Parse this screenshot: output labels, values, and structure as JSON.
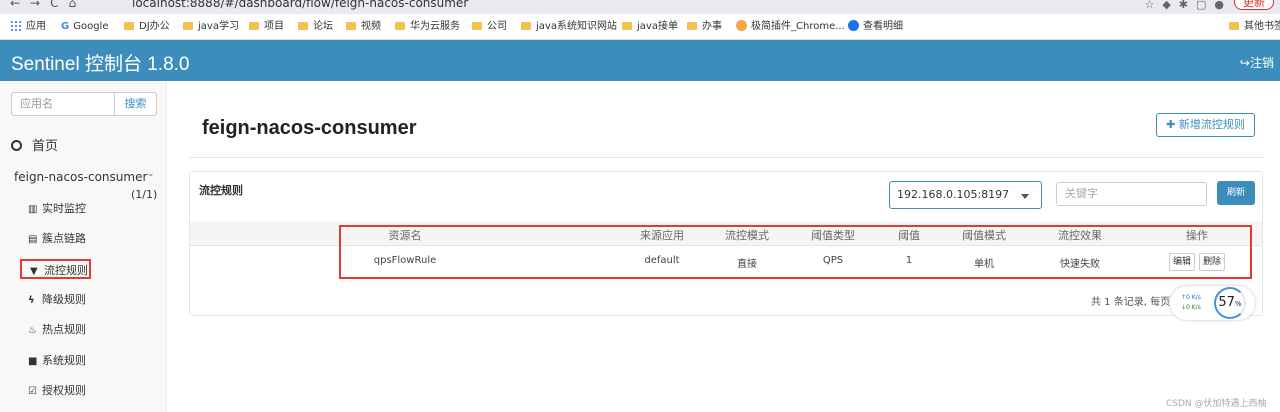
{
  "browser": {
    "url": "localhost:8888/#/dashboard/flow/feign-nacos-consumer",
    "update_label": "更新",
    "bookmarks": [
      "应用",
      "Google",
      "DJ办公",
      "java学习",
      "项目",
      "论坛",
      "视频",
      "华为云服务",
      "公司",
      "java系统知识网站",
      "java接单",
      "办事",
      "极简插件_Chrome...",
      "查看明细"
    ],
    "other_bookmarks": "其他书签"
  },
  "header": {
    "title": "Sentinel 控制台 1.8.0",
    "logout_label": "注销"
  },
  "sidebar": {
    "search_placeholder": "应用名",
    "search_button": "搜索",
    "home_label": "首页",
    "app_name": "feign-nacos-consumer",
    "app_count": "(1/1)",
    "items": [
      {
        "label": "实时监控",
        "icon": "bar-chart-icon"
      },
      {
        "label": "簇点链路",
        "icon": "list-icon"
      },
      {
        "label": "流控规则",
        "icon": "filter-icon"
      },
      {
        "label": "降级规则",
        "icon": "flash-icon"
      },
      {
        "label": "热点规则",
        "icon": "fire-icon"
      },
      {
        "label": "系统规则",
        "icon": "lock-icon"
      },
      {
        "label": "授权规则",
        "icon": "check-icon"
      }
    ]
  },
  "main": {
    "page_title": "feign-nacos-consumer",
    "add_button": "新增流控规则",
    "panel_title": "流控规则",
    "machine_select": "192.168.0.105:8197",
    "keyword_placeholder": "关键字",
    "refresh_button": "刷新",
    "columns": [
      "资源名",
      "来源应用",
      "流控模式",
      "阈值类型",
      "阈值",
      "阈值模式",
      "流控效果",
      "操作"
    ],
    "rows": [
      {
        "resource": "qpsFlowRule",
        "origin": "default",
        "mode": "直接",
        "grade": "QPS",
        "count": "1",
        "cluster": "单机",
        "effect": "快速失败",
        "edit": "编辑",
        "delete": "删除"
      }
    ],
    "pager_text": "共 1 条记录, 每页"
  },
  "net_widget": {
    "up": "↑0  K/s",
    "down": "↓0  K/s",
    "percent": "57",
    "percent_unit": "%"
  },
  "watermark": "CSDN @伏加特遇上西柚",
  "colors": {
    "header_bg": "#3c8dbc",
    "accent": "#3c8dbc",
    "highlight_red": "#e53935"
  }
}
